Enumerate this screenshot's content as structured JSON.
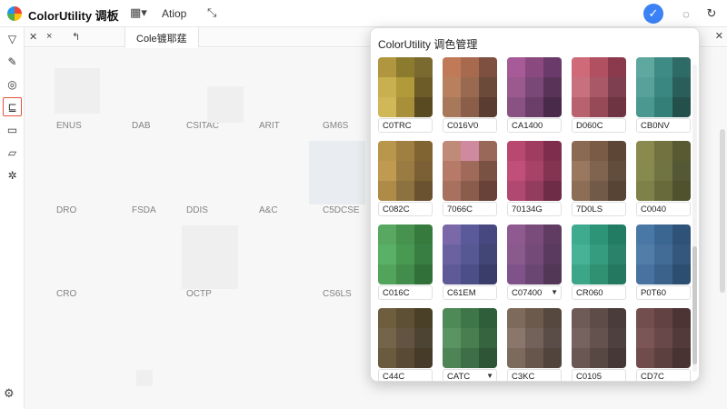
{
  "app": {
    "title": "ColorUtility 调板"
  },
  "toolbar": {
    "menu_text": "Atiop"
  },
  "tabs": {
    "active_label": "Cole镀耶莛"
  },
  "background_cells": [
    {
      "label": "ENUS",
      "col": 0,
      "row": 0
    },
    {
      "label": "DAB",
      "col": 1,
      "row": 0
    },
    {
      "label": "CSITAC",
      "col": 2,
      "row": 0
    },
    {
      "label": "ARIT",
      "col": 3,
      "row": 0
    },
    {
      "label": "GM6S",
      "col": 4,
      "row": 0
    },
    {
      "label": "DRO",
      "col": 0,
      "row": 1
    },
    {
      "label": "FSDA",
      "col": 1,
      "row": 1
    },
    {
      "label": "DDIS",
      "col": 2,
      "row": 1
    },
    {
      "label": "A&C",
      "col": 3,
      "row": 1
    },
    {
      "label": "C5DCSE",
      "col": 4,
      "row": 1
    },
    {
      "label": "CRO",
      "col": 0,
      "row": 2
    },
    {
      "label": "OCTP",
      "col": 2,
      "row": 2
    },
    {
      "label": "CS6LS",
      "col": 4,
      "row": 2
    }
  ],
  "popup": {
    "title": "ColorUtility 调色管理",
    "swatches": [
      {
        "label": "C0TRC",
        "colors": [
          "#b0963e",
          "#8c7a2e",
          "#7a6a30",
          "#c8b050",
          "#b09a3a",
          "#6e5c28",
          "#d0b858",
          "#a8903a",
          "#5a4a22"
        ]
      },
      {
        "label": "C016V0",
        "colors": [
          "#c07a58",
          "#a86a4e",
          "#7e5040",
          "#b8805e",
          "#9a6a50",
          "#6c4a3a",
          "#a8785a",
          "#8a5e48",
          "#5a3c30"
        ]
      },
      {
        "label": "CA1400",
        "colors": [
          "#a75a98",
          "#8a4a80",
          "#6a3a6a",
          "#9a5a8e",
          "#7a4876",
          "#5a3458",
          "#8a5282",
          "#6a3e68",
          "#4a2a4a"
        ]
      },
      {
        "label": "D060C",
        "colors": [
          "#cf6a78",
          "#b05060",
          "#8a3a4c",
          "#c8707e",
          "#a85866",
          "#7e4050",
          "#b86270",
          "#964a58",
          "#6e3442"
        ]
      },
      {
        "label": "CB0NV",
        "colors": [
          "#5fa8a0",
          "#3e8a84",
          "#2e6a66",
          "#58a09a",
          "#3a8680",
          "#2a5e5a",
          "#4a9890",
          "#348078",
          "#24504c"
        ]
      },
      {
        "label": "C082C",
        "colors": [
          "#b8974c",
          "#a08040",
          "#806432",
          "#c09a50",
          "#9a7c42",
          "#7a6034",
          "#ae8c48",
          "#8c723e",
          "#6a5230"
        ]
      },
      {
        "label": "7066C",
        "colors": [
          "#c08a78",
          "#d08aa0",
          "#9a6858",
          "#b87a68",
          "#a06a5a",
          "#7a5244",
          "#a8705e",
          "#8a5c4c",
          "#684238"
        ]
      },
      {
        "label": "70134G",
        "colors": [
          "#b84870",
          "#a03c60",
          "#7e2e4c",
          "#c0507a",
          "#a84266",
          "#843450",
          "#b04872",
          "#943c5e",
          "#6e2c46"
        ]
      },
      {
        "label": "7D0LS",
        "colors": [
          "#8a6a52",
          "#7a5c46",
          "#5e4636",
          "#9a7860",
          "#806450",
          "#624c3c",
          "#8c6e56",
          "#725a48",
          "#584434"
        ]
      },
      {
        "label": "C0040",
        "colors": [
          "#8a8a4e",
          "#727240",
          "#5a5a32",
          "#868a4e",
          "#707442",
          "#545834",
          "#7e8248",
          "#686a3c",
          "#50522e"
        ]
      },
      {
        "label": "C016C",
        "colors": [
          "#58a862",
          "#46924e",
          "#367a3e",
          "#5ab066",
          "#489a52",
          "#387e42",
          "#52a45c",
          "#428c4c",
          "#32703a"
        ]
      },
      {
        "label": "C61EM",
        "colors": [
          "#7a68a8",
          "#5a5a9a",
          "#484880",
          "#6a62a0",
          "#565894",
          "#424676",
          "#5e5a98",
          "#4c4e88",
          "#3a3c6a"
        ]
      },
      {
        "label": "C07400",
        "colors": [
          "#8e5a90",
          "#7a4c7c",
          "#603c62",
          "#8a5a8c",
          "#744a78",
          "#5a3a5e",
          "#80528a",
          "#6a4672",
          "#523856"
        ]
      },
      {
        "label": "CR060",
        "colors": [
          "#3eaa8e",
          "#2e9478",
          "#227c64",
          "#48b296",
          "#369c80",
          "#2a826a",
          "#3ea688",
          "#309072",
          "#247860"
        ]
      },
      {
        "label": "P0T60",
        "colors": [
          "#4a78a6",
          "#3c6692",
          "#2e5278",
          "#507ea8",
          "#426c96",
          "#34587c",
          "#4872a0",
          "#3a628a",
          "#2c4e70"
        ]
      },
      {
        "label": "C44C",
        "colors": [
          "#6e5e3e",
          "#5e5034",
          "#4a4028",
          "#74644a",
          "#625440",
          "#4e4434",
          "#6a5a3e",
          "#584a34",
          "#463a28"
        ]
      },
      {
        "label": "CATC",
        "colors": [
          "#4e8a58",
          "#3e764a",
          "#2e5e3a",
          "#5a9462",
          "#487e50",
          "#36643e",
          "#4e8456",
          "#3e6e46",
          "#2e5636"
        ]
      },
      {
        "label": "C3KC",
        "colors": [
          "#7e6a5a",
          "#6c5a4c",
          "#56483e",
          "#8a766a",
          "#72625a",
          "#5a4c46",
          "#7c6a5c",
          "#66564c",
          "#50443c"
        ]
      },
      {
        "label": "C0105",
        "colors": [
          "#6e5a56",
          "#5e4c48",
          "#4a3c3a",
          "#76625e",
          "#64524e",
          "#4e403e",
          "#6a5652",
          "#584844",
          "#463836"
        ]
      },
      {
        "label": "CD7C",
        "colors": [
          "#744e4e",
          "#624242",
          "#4c3434",
          "#7c5656",
          "#684848",
          "#523a3a",
          "#704c4c",
          "#5c4040",
          "#483232"
        ]
      }
    ],
    "caret_labels": [
      "C07400",
      "CATC"
    ]
  }
}
